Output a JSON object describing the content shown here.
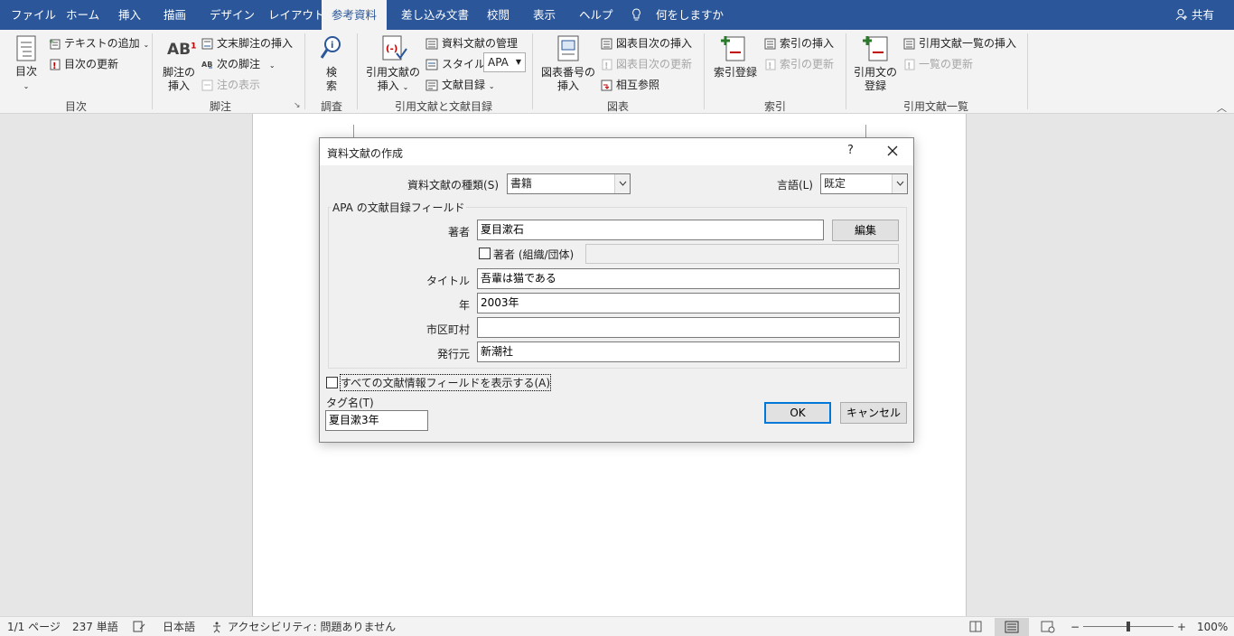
{
  "tabs": [
    {
      "label": "ファイル"
    },
    {
      "label": "ホーム"
    },
    {
      "label": "挿入"
    },
    {
      "label": "描画"
    },
    {
      "label": "デザイン"
    },
    {
      "label": "レイアウト"
    },
    {
      "label": "参考資料"
    },
    {
      "label": "差し込み文書"
    },
    {
      "label": "校閲"
    },
    {
      "label": "表示"
    },
    {
      "label": "ヘルプ"
    }
  ],
  "tell_me": "何をしますか",
  "share": "共有",
  "ribbon": {
    "toc": {
      "big": "目次",
      "add_text": "テキストの追加",
      "update": "目次の更新",
      "group": "目次"
    },
    "footnotes": {
      "insert_line1": "脚注の",
      "insert_line2": "挿入",
      "endnote": "文末脚注の挿入",
      "next": "次の脚注",
      "show": "注の表示",
      "group": "脚注",
      "ab_text": "AB"
    },
    "research": {
      "line1": "検",
      "line2": "索",
      "group": "調査"
    },
    "citations": {
      "insert_line1": "引用文献の",
      "insert_line2": "挿入",
      "manage": "資料文献の管理",
      "style_label": "スタイル:",
      "style_value": "APA",
      "bibliography": "文献目録",
      "group": "引用文献と文献目録"
    },
    "captions": {
      "insert_line1": "図表番号の",
      "insert_line2": "挿入",
      "insert_tof": "図表目次の挿入",
      "update_tof": "図表目次の更新",
      "cross_ref": "相互参照",
      "group": "図表"
    },
    "index": {
      "mark": "索引登録",
      "insert": "索引の挿入",
      "update": "索引の更新",
      "group": "索引"
    },
    "toa": {
      "mark_line1": "引用文の",
      "mark_line2": "登録",
      "insert": "引用文献一覧の挿入",
      "update": "一覧の更新",
      "group": "引用文献一覧"
    }
  },
  "dialog": {
    "title": "資料文献の作成",
    "help": "?",
    "source_type_label": "資料文献の種類(S)",
    "source_type_value": "書籍",
    "language_label": "言語(L)",
    "language_value": "既定",
    "group_label": "APA の文献目録フィールド",
    "author_label": "著者",
    "author_value": "夏目漱石",
    "edit_button": "編集",
    "corporate_label": "著者 (組織/団体)",
    "title_label": "タイトル",
    "title_value": "吾輩は猫である",
    "year_label": "年",
    "year_value": "2003年",
    "city_label": "市区町村",
    "city_value": "",
    "publisher_label": "発行元",
    "publisher_value": "新潮社",
    "show_all_label": "すべての文献情報フィールドを表示する(A)",
    "tag_label": "タグ名(T)",
    "tag_value": "夏目漱3年",
    "ok": "OK",
    "cancel": "キャンセル"
  },
  "status": {
    "page": "1/1 ページ",
    "words": "237 単語",
    "language": "日本語",
    "accessibility": "アクセシビリティ: 問題ありません",
    "zoom": "100%",
    "zoom_minus": "−",
    "zoom_plus": "+"
  },
  "colors": {
    "accent": "#2b579a",
    "ribbon_bg": "#f3f3f3",
    "dialog_bg": "#f0f0f0",
    "ok_border": "#0078d7"
  }
}
